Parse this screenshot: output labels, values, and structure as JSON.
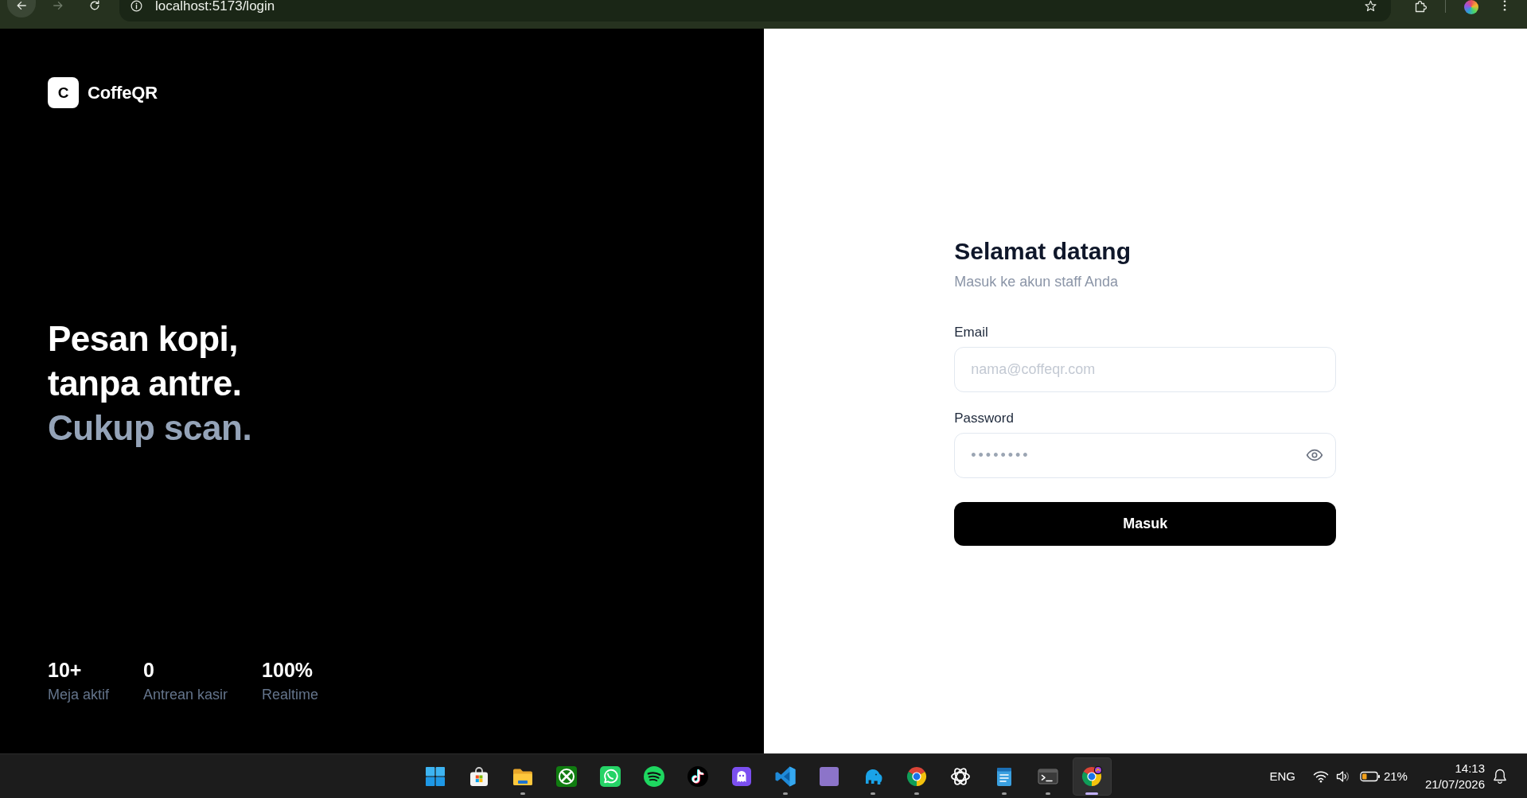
{
  "browser": {
    "nav": [
      {
        "kind": "back",
        "disabled": false,
        "hovered": true
      },
      {
        "kind": "forward",
        "disabled": true,
        "hovered": false
      },
      {
        "kind": "reload",
        "disabled": false,
        "hovered": false
      }
    ],
    "url": "localhost:5173/login"
  },
  "brand": {
    "logo_letter": "C",
    "name": "CoffeQR"
  },
  "hero": {
    "lines": [
      {
        "text": "Pesan kopi,",
        "muted": false
      },
      {
        "text": "tanpa antre.",
        "muted": false
      },
      {
        "text": "Cukup scan.",
        "muted": true
      }
    ]
  },
  "stats": [
    {
      "value": "10+",
      "label": "Meja aktif"
    },
    {
      "value": "0",
      "label": "Antrean kasir"
    },
    {
      "value": "100%",
      "label": "Realtime"
    }
  ],
  "login": {
    "title": "Selamat datang",
    "subtitle": "Masuk ke akun staff Anda",
    "fields": [
      {
        "kind": "email",
        "label": "Email",
        "placeholder": "nama@coffeqr.com"
      },
      {
        "kind": "password",
        "label": "Password",
        "placeholder": "••••••••"
      }
    ],
    "submit": "Masuk"
  },
  "taskbar": {
    "apps": [
      {
        "kind": "start",
        "running": false,
        "selected": false
      },
      {
        "kind": "bag",
        "running": false,
        "selected": false
      },
      {
        "kind": "folder",
        "running": true,
        "selected": false
      },
      {
        "kind": "x-tile",
        "running": false,
        "selected": false
      },
      {
        "kind": "chat-bubble",
        "running": false,
        "selected": false
      },
      {
        "kind": "sound-waves",
        "running": false,
        "selected": false
      },
      {
        "kind": "music-note",
        "running": false,
        "selected": false
      },
      {
        "kind": "ghost",
        "running": false,
        "selected": false
      },
      {
        "kind": "ribbon",
        "running": true,
        "selected": false
      },
      {
        "kind": "picture",
        "running": false,
        "selected": false
      },
      {
        "kind": "elephant",
        "running": true,
        "selected": false
      },
      {
        "kind": "browser",
        "running": true,
        "selected": false
      },
      {
        "kind": "atom",
        "running": false,
        "selected": false
      },
      {
        "kind": "notepad",
        "running": true,
        "selected": false
      },
      {
        "kind": "terminal",
        "running": true,
        "selected": false
      },
      {
        "kind": "browser-badge",
        "running": true,
        "selected": true
      }
    ],
    "tray": {
      "language": "ENG",
      "battery": "21%",
      "time": "14:13",
      "date": "21/07/2026"
    }
  }
}
